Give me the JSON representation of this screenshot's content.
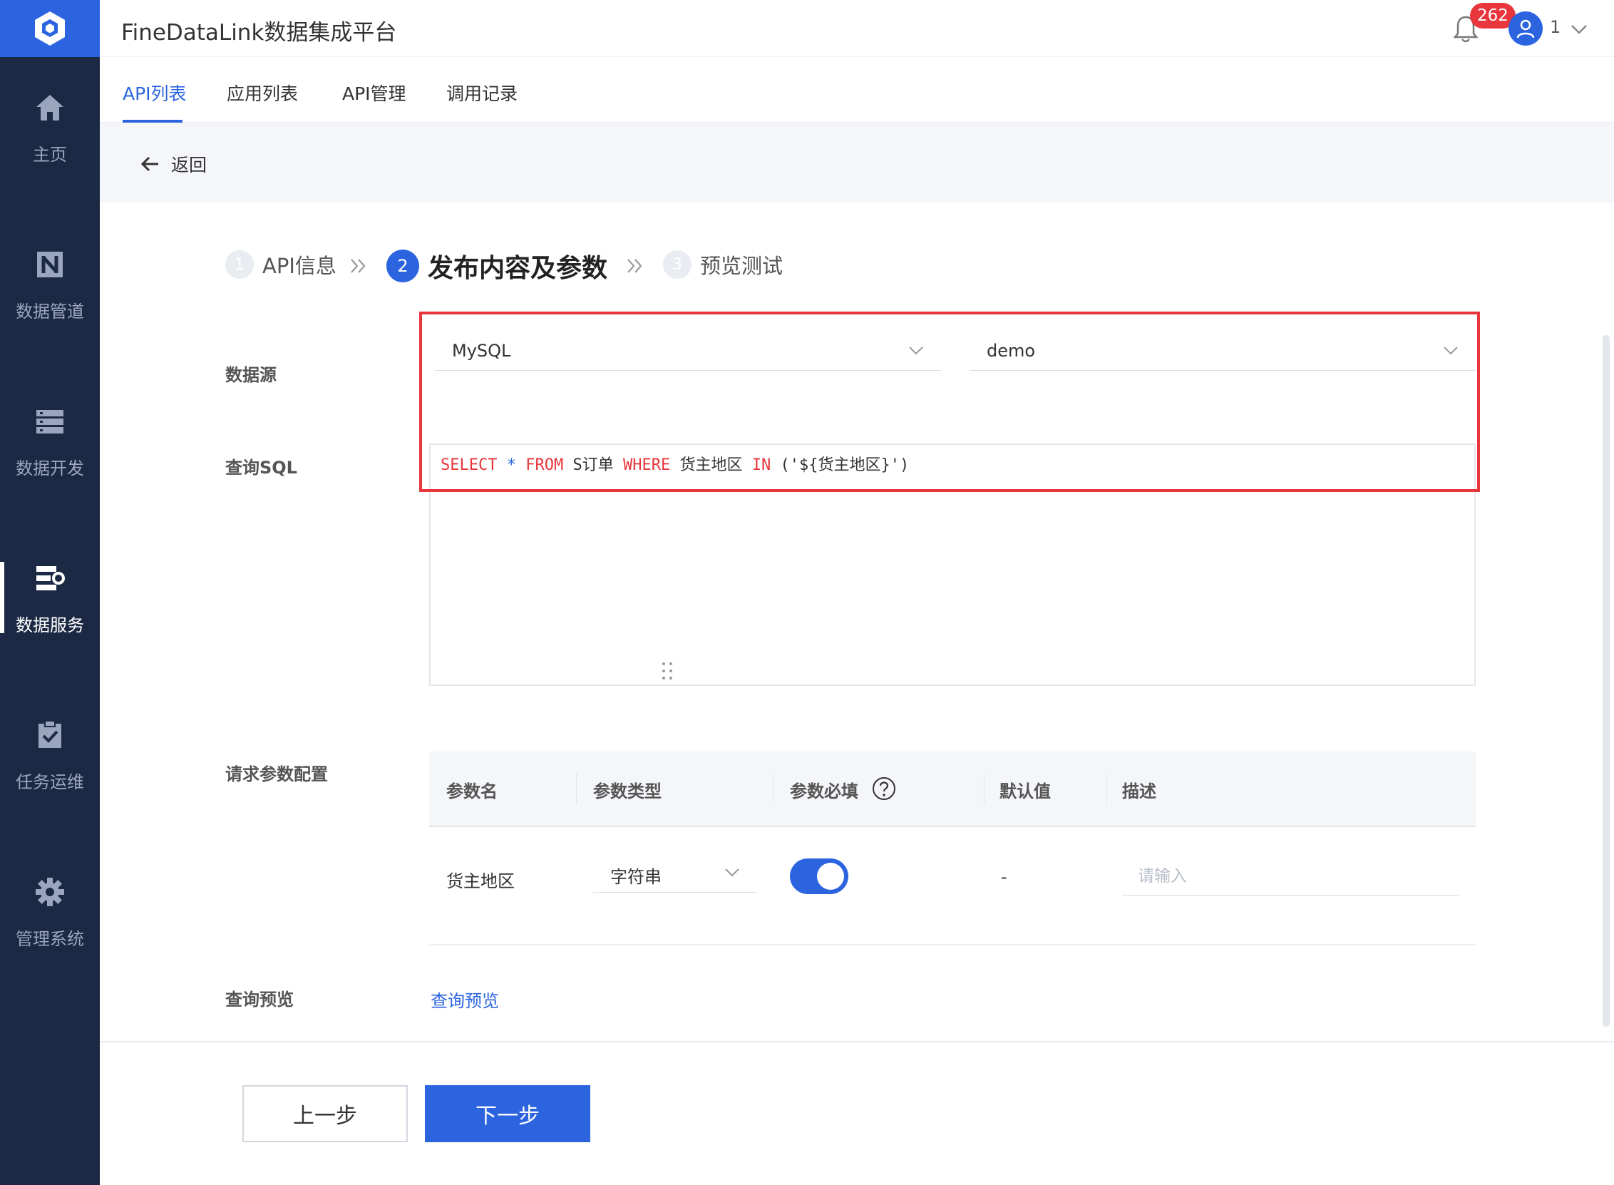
{
  "app": {
    "title": "FineDataLink数据集成平台"
  },
  "header": {
    "notification_count": "262",
    "user_name": "1"
  },
  "sidebar": {
    "items": [
      {
        "label": "主页",
        "icon": "home-icon"
      },
      {
        "label": "数据管道",
        "icon": "pipeline-icon"
      },
      {
        "label": "数据开发",
        "icon": "develop-icon"
      },
      {
        "label": "数据服务",
        "icon": "service-icon",
        "active": true
      },
      {
        "label": "任务运维",
        "icon": "task-icon"
      },
      {
        "label": "管理系统",
        "icon": "gear-icon"
      }
    ]
  },
  "tabs": [
    {
      "label": "API列表",
      "active": true
    },
    {
      "label": "应用列表"
    },
    {
      "label": "API管理"
    },
    {
      "label": "调用记录"
    }
  ],
  "back": {
    "label": "返回"
  },
  "steps": [
    {
      "num": "1",
      "label": "API信息"
    },
    {
      "num": "2",
      "label": "发布内容及参数",
      "active": true
    },
    {
      "num": "3",
      "label": "预览测试"
    }
  ],
  "form": {
    "datasource_label": "数据源",
    "datasource_type": "MySQL",
    "datasource_db": "demo",
    "sql_label": "查询SQL",
    "sql": {
      "t1": "SELECT",
      "t2": "*",
      "t3": "FROM",
      "t4": "S订单",
      "t5": "WHERE",
      "t6": "货主地区",
      "t7": "IN",
      "t8": "('${货主地区}')"
    },
    "params_label": "请求参数配置",
    "preview_label": "查询预览",
    "preview_link": "查询预览"
  },
  "params_table": {
    "headers": [
      "参数名",
      "参数类型",
      "参数必填",
      "默认值",
      "描述"
    ],
    "rows": [
      {
        "name": "货主地区",
        "type": "字符串",
        "required": true,
        "default": "-",
        "desc_placeholder": "请输入"
      }
    ]
  },
  "footer": {
    "prev": "上一步",
    "next": "下一步"
  },
  "colors": {
    "accent": "#2c64e0",
    "sidebar": "#1c2944",
    "highlight": "#e8363c"
  }
}
